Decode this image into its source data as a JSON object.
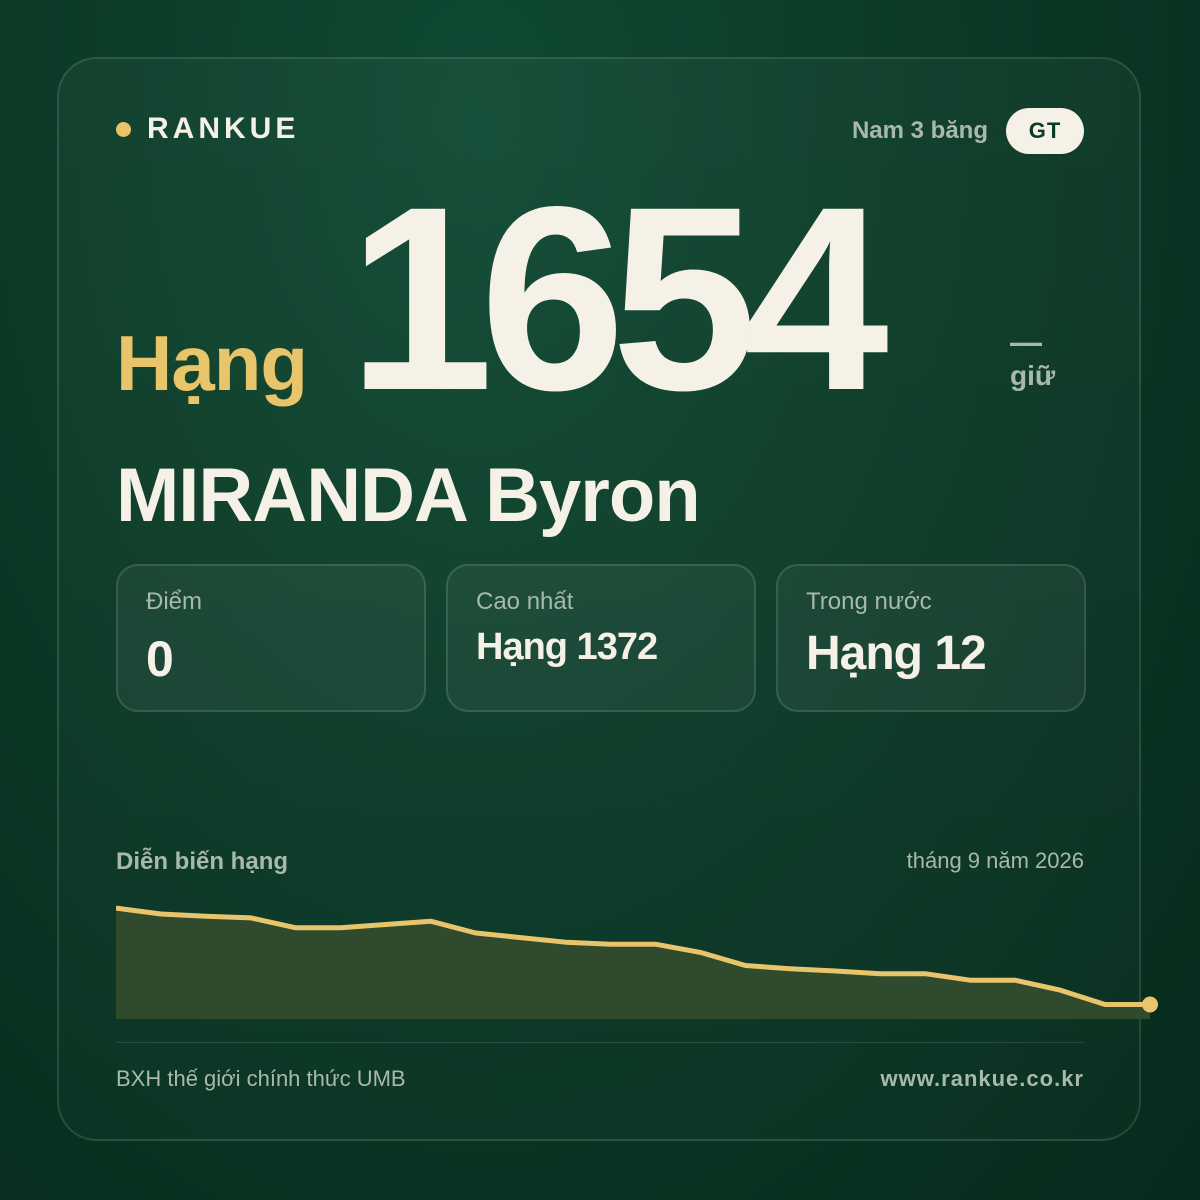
{
  "brand": {
    "name": "RANKUE",
    "accent": "#e8c46a"
  },
  "category": {
    "label": "Nam 3 băng",
    "badge": "GT"
  },
  "rank": {
    "word": "Hạng",
    "number": "1654",
    "trend_symbol": "—",
    "trend_label": "giữ"
  },
  "player": {
    "name": "MIRANDA Byron"
  },
  "stats": [
    {
      "label": "Điểm",
      "value": "0"
    },
    {
      "label": "Cao nhất",
      "value": "Hạng 1372"
    },
    {
      "label": "Trong nước",
      "value": "Hạng 12"
    }
  ],
  "chart": {
    "title": "Diễn biến hạng",
    "date": "tháng 9 năm 2026"
  },
  "chart_data": {
    "type": "area",
    "y_inverted": true,
    "ylim": [
      1320,
      1680
    ],
    "line_color": "#e8c46a",
    "fill_color": "#2f4a2c",
    "values": [
      1360,
      1378,
      1385,
      1390,
      1420,
      1420,
      1410,
      1400,
      1436,
      1450,
      1464,
      1470,
      1470,
      1495,
      1535,
      1545,
      1552,
      1560,
      1560,
      1580,
      1580,
      1610,
      1654,
      1654
    ]
  },
  "footer": {
    "left": "BXH thế giới chính thức UMB",
    "right": "www.rankue.co.kr"
  }
}
